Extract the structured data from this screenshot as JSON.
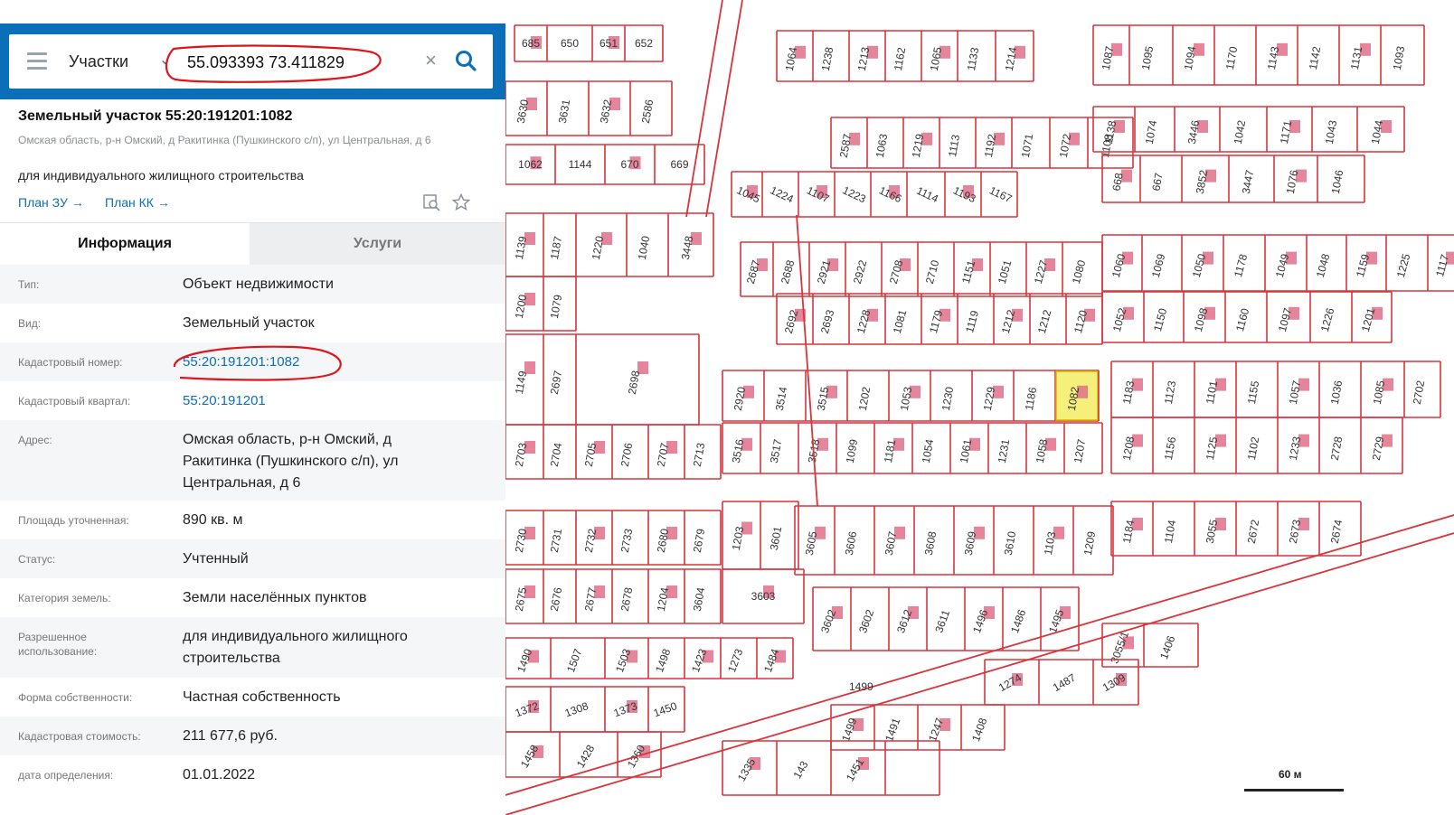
{
  "search": {
    "layer_label": "Участки",
    "query": "55.093393 73.411829"
  },
  "parcel": {
    "title": "Земельный участок 55:20:191201:1082",
    "address_short": "Омская область, р-н Омский, д Ракитинка (Пушкинского с/п), ул Центральная, д 6",
    "use": "для индивидуального жилищного строительства",
    "link_plan_zu": "План ЗУ →",
    "link_plan_kk": "План КК →"
  },
  "tabs": {
    "info": "Информация",
    "services": "Услуги"
  },
  "info_rows": [
    {
      "key": "Тип:",
      "value": "Объект недвижимости"
    },
    {
      "key": "Вид:",
      "value": "Земельный участок"
    },
    {
      "key": "Кадастровый номер:",
      "value": "55:20:191201:1082"
    },
    {
      "key": "Кадастровый квартал:",
      "value": "55:20:191201"
    },
    {
      "key": "Адрес:",
      "value": "Омская область, р-н Омский, д Ракитинка (Пушкинского с/п), ул Центральная, д 6"
    },
    {
      "key": "Площадь уточненная:",
      "value": "890 кв. м"
    },
    {
      "key": "Статус:",
      "value": "Учтенный"
    },
    {
      "key": "Категория земель:",
      "value": "Земли населённых пунктов"
    },
    {
      "key": "Разрешенное использование:",
      "value": "для индивидуального жилищного строительства"
    },
    {
      "key": "Форма собственности:",
      "value": "Частная собственность"
    },
    {
      "key": "Кадастровая стоимость:",
      "value": "211 677,6 руб."
    },
    {
      "key": "дата определения:",
      "value": "01.01.2022"
    }
  ],
  "map": {
    "scale_label": "60 м",
    "highlight_color": "#f5f07a",
    "line_color": "#d9343c",
    "parcel_labels": [
      "685",
      "650",
      "651",
      "652",
      "1064",
      "1238",
      "1213",
      "1162",
      "1065",
      "1133",
      "1214",
      "1087",
      "1095",
      "1094",
      "1170",
      "1143",
      "1142",
      "1131",
      "1093",
      "3630",
      "3631",
      "3632",
      "2586",
      "2587",
      "1063",
      "1219",
      "1113",
      "1192",
      "1071",
      "1072",
      "1108",
      "1138",
      "1074",
      "3446",
      "1042",
      "1171",
      "1043",
      "1044",
      "1062",
      "1144",
      "670",
      "669",
      "668",
      "667",
      "3852",
      "3447",
      "1076",
      "1046",
      "1045",
      "1224",
      "1107",
      "1223",
      "1166",
      "1114",
      "1193",
      "1167",
      "1139",
      "1187",
      "1220",
      "1040",
      "3448",
      "2687",
      "2688",
      "2921",
      "2922",
      "2708",
      "2710",
      "1151",
      "1051",
      "1227",
      "1080",
      "1060",
      "1069",
      "1050",
      "1178",
      "1049",
      "1048",
      "1159",
      "1225",
      "1117",
      "1200",
      "1079",
      "2692",
      "2693",
      "1228",
      "1081",
      "1179",
      "1119",
      "1212",
      "1212",
      "1120",
      "1052",
      "1150",
      "1098",
      "1160",
      "1097",
      "1226",
      "1201",
      "1149",
      "2697",
      "2698",
      "2920",
      "3514",
      "3515",
      "1202",
      "1053",
      "1230",
      "1229",
      "1186",
      "1082",
      "1183",
      "1123",
      "1101",
      "1155",
      "1057",
      "1036",
      "1085",
      "2702",
      "2703",
      "2704",
      "2705",
      "2706",
      "2707",
      "2713",
      "3516",
      "3517",
      "3518",
      "1099",
      "1181",
      "1054",
      "1061",
      "1231",
      "1058",
      "1207",
      "1208",
      "1156",
      "1125",
      "1102",
      "1233",
      "2728",
      "2729",
      "2730",
      "2731",
      "2732",
      "2733",
      "2680",
      "2679",
      "1203",
      "3601",
      "3605",
      "3606",
      "3607",
      "3608",
      "3609",
      "3610",
      "1103",
      "1209",
      "1184",
      "1104",
      "3055",
      "2672",
      "2673",
      "2674",
      "2675",
      "2676",
      "2677",
      "2678",
      "1204",
      "3604",
      "3603",
      "3602",
      "3602",
      "3612",
      "3611",
      "1496",
      "1486",
      "1495",
      "1490",
      "1507",
      "1503",
      "1498",
      "1423",
      "1273",
      "1484",
      "3055/1",
      "1406",
      "1372",
      "1308",
      "1373",
      "1450",
      "1499",
      "1491",
      "1247",
      "1408",
      "1274",
      "1487",
      "1309",
      "1458",
      "1428",
      "1360",
      "1335",
      "143",
      "1451"
    ]
  }
}
